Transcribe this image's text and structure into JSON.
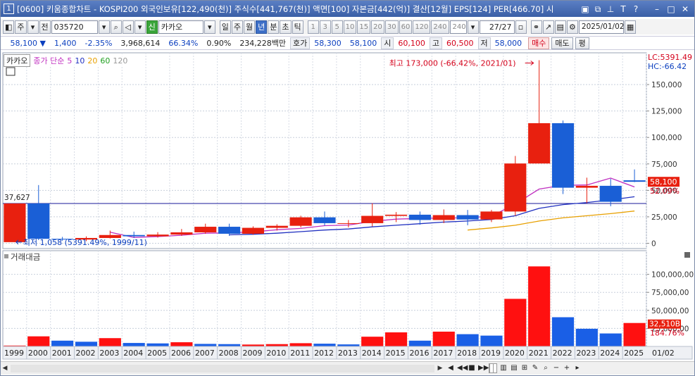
{
  "window": {
    "number": "1",
    "title": "[0600] 키움종합차트 - KOSPI200 외국인보유[122,490(천)] 주식수[441,767(천)] 액면[100] 자본금[442(억)] 결산[12월] EPS[124] PER[466.70] 시"
  },
  "toolbar": {
    "market": "주",
    "scope": "전",
    "code": "035720",
    "new_badge": "신",
    "name": "카카오",
    "periods": [
      "일",
      "주",
      "월",
      "년",
      "분",
      "초",
      "틱"
    ],
    "selected_period": "년",
    "intervals": [
      "1",
      "3",
      "5",
      "10",
      "15",
      "20",
      "30",
      "60",
      "120",
      "240"
    ],
    "interval_value": "240",
    "count": "27/27",
    "date": "2025/01/02"
  },
  "quote": {
    "price": "58,100",
    "change": "1,400",
    "change_pct": "-2.35%",
    "volume": "3,968,614",
    "vol_ratio": "66.34%",
    "turnover_pct": "0.90%",
    "amount": "234,228백만",
    "ask_label": "호가",
    "ask": "58,300",
    "bid": "58,100",
    "open_label": "시",
    "open": "60,100",
    "high_label": "고",
    "high": "60,500",
    "low_label": "저",
    "low": "58,000",
    "buy": "매수",
    "sell": "매도",
    "eval": "평"
  },
  "legend": {
    "name": "카카오",
    "ma_label": "종가 단순",
    "ma": [
      "5",
      "10",
      "20",
      "60",
      "120"
    ],
    "ma_colors": [
      "#c030c0",
      "#2030c0",
      "#e8a000",
      "#20a020",
      "#999999"
    ]
  },
  "volume_panel": {
    "title": "거래대금",
    "last_label": "32,510B",
    "last_pct": "184.76%",
    "last_date": "01/02"
  },
  "price_panel": {
    "lc": "LC:5391.49",
    "hc": "HC:-66.42",
    "hline": "37,627",
    "last_price": "58,100",
    "last_pct": "52.09%",
    "max_note": "최고 173,000 (-66.42%, 2021/01)",
    "min_note": "최저 1,058 (5391.49%, 1999/11)"
  },
  "chart_data": [
    {
      "type": "candlestick",
      "title": "",
      "x": [
        "1999",
        "2000",
        "2001",
        "2002",
        "2003",
        "2004",
        "2005",
        "2006",
        "2007",
        "2008",
        "2009",
        "2010",
        "2011",
        "2012",
        "2013",
        "2014",
        "2015",
        "2016",
        "2017",
        "2018",
        "2019",
        "2020",
        "2021",
        "2022",
        "2023",
        "2024",
        "2025"
      ],
      "open": [
        1058,
        37600,
        4200,
        3500,
        5000,
        7800,
        6600,
        8200,
        10300,
        15600,
        9000,
        14600,
        16500,
        24500,
        19000,
        19000,
        25900,
        27000,
        22000,
        26600,
        22500,
        30000,
        75400,
        113500,
        52500,
        54300,
        59500
      ],
      "close": [
        37600,
        4200,
        3500,
        5000,
        7800,
        6600,
        8200,
        10300,
        15600,
        9000,
        14600,
        16500,
        24500,
        19000,
        19000,
        25900,
        27000,
        22000,
        26600,
        22500,
        30000,
        75400,
        113500,
        52500,
        54300,
        39200,
        58100
      ],
      "high": [
        37600,
        55000,
        6000,
        6500,
        12000,
        11000,
        10500,
        13500,
        18500,
        18500,
        16000,
        18000,
        26000,
        30000,
        22000,
        37800,
        29500,
        30000,
        32000,
        31500,
        31500,
        82500,
        173000,
        116000,
        62000,
        61000,
        69800
      ],
      "low": [
        1058,
        3000,
        2400,
        2000,
        4500,
        5000,
        5400,
        7000,
        9000,
        7000,
        8000,
        12000,
        15000,
        16500,
        15000,
        16000,
        20000,
        17500,
        19000,
        17000,
        20000,
        26000,
        76000,
        46500,
        38000,
        35000,
        57800
      ],
      "ma5": [
        null,
        null,
        null,
        null,
        10500,
        5500,
        6300,
        7600,
        9500,
        9800,
        10800,
        12800,
        14000,
        16600,
        17200,
        20700,
        22800,
        23500,
        23800,
        24000,
        25600,
        37100,
        51200,
        54800,
        55100,
        61600,
        53200
      ],
      "ma10": [
        null,
        null,
        null,
        null,
        null,
        null,
        null,
        null,
        null,
        8000,
        8500,
        9500,
        11000,
        12500,
        13500,
        15500,
        17000,
        18500,
        20000,
        21000,
        22500,
        26000,
        33000,
        36500,
        38500,
        41000,
        44000
      ],
      "ma20": [
        null,
        null,
        null,
        null,
        null,
        null,
        null,
        null,
        null,
        null,
        null,
        null,
        null,
        null,
        null,
        null,
        null,
        null,
        null,
        12500,
        14500,
        17000,
        21000,
        24000,
        26000,
        28000,
        30500
      ],
      "ylim": [
        -5000,
        180000
      ],
      "yticks": [
        "0",
        "25,000",
        "50,000",
        "75,000",
        "100,000",
        "125,000",
        "150,000"
      ]
    },
    {
      "type": "bar",
      "title": "거래대금",
      "x": [
        "1999",
        "2000",
        "2001",
        "2002",
        "2003",
        "2004",
        "2005",
        "2006",
        "2007",
        "2008",
        "2009",
        "2010",
        "2011",
        "2012",
        "2013",
        "2014",
        "2015",
        "2016",
        "2017",
        "2018",
        "2019",
        "2020",
        "2021",
        "2022",
        "2023",
        "2024",
        "2025"
      ],
      "values": [
        1200,
        14000,
        8000,
        6500,
        11500,
        4800,
        4200,
        5800,
        3500,
        3200,
        2600,
        3200,
        4500,
        3800,
        2800,
        13500,
        19500,
        8000,
        20500,
        17000,
        15000,
        66000,
        111000,
        40500,
        24500,
        18000,
        32510
      ],
      "colors": [
        "r",
        "r",
        "b",
        "b",
        "r",
        "b",
        "b",
        "r",
        "b",
        "b",
        "r",
        "r",
        "r",
        "b",
        "b",
        "r",
        "r",
        "b",
        "r",
        "b",
        "b",
        "r",
        "r",
        "b",
        "b",
        "b",
        "r"
      ],
      "ylim": [
        0,
        125000
      ],
      "yticks": [
        "25,000,00",
        "50,000,00",
        "75,000,00",
        "100,000,00"
      ]
    }
  ]
}
